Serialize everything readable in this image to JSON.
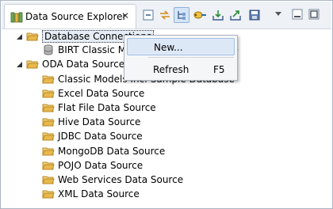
{
  "view": {
    "title": "Data Source Explorer",
    "close_glyph": "✕"
  },
  "toolbar": [
    {
      "name": "collapse-all-icon"
    },
    {
      "name": "link-with-editor-icon"
    },
    {
      "name": "show-hierarchy-icon",
      "pressed": true
    },
    {
      "name": "connect-icon"
    },
    {
      "name": "import-icon"
    },
    {
      "name": "export-icon"
    },
    {
      "name": "save-icon"
    }
  ],
  "tree": {
    "database_connections": {
      "label": "Database Connections",
      "children": [
        "BIRT Classic Models Sample Database"
      ]
    },
    "oda_data_sources": {
      "label": "ODA Data Sources",
      "children": [
        "Classic Models Inc. Sample Database",
        "Excel Data Source",
        "Flat File Data Source",
        "Hive Data Source",
        "JDBC Data Source",
        "MongoDB Data Source",
        "POJO Data Source",
        "Web Services Data Source",
        "XML Data Source"
      ]
    }
  },
  "context_menu": {
    "new_label": "New...",
    "refresh_label": "Refresh",
    "refresh_shortcut": "F5"
  },
  "colors": {
    "folder": "#e8b94a",
    "selection": "#dde8f7"
  }
}
